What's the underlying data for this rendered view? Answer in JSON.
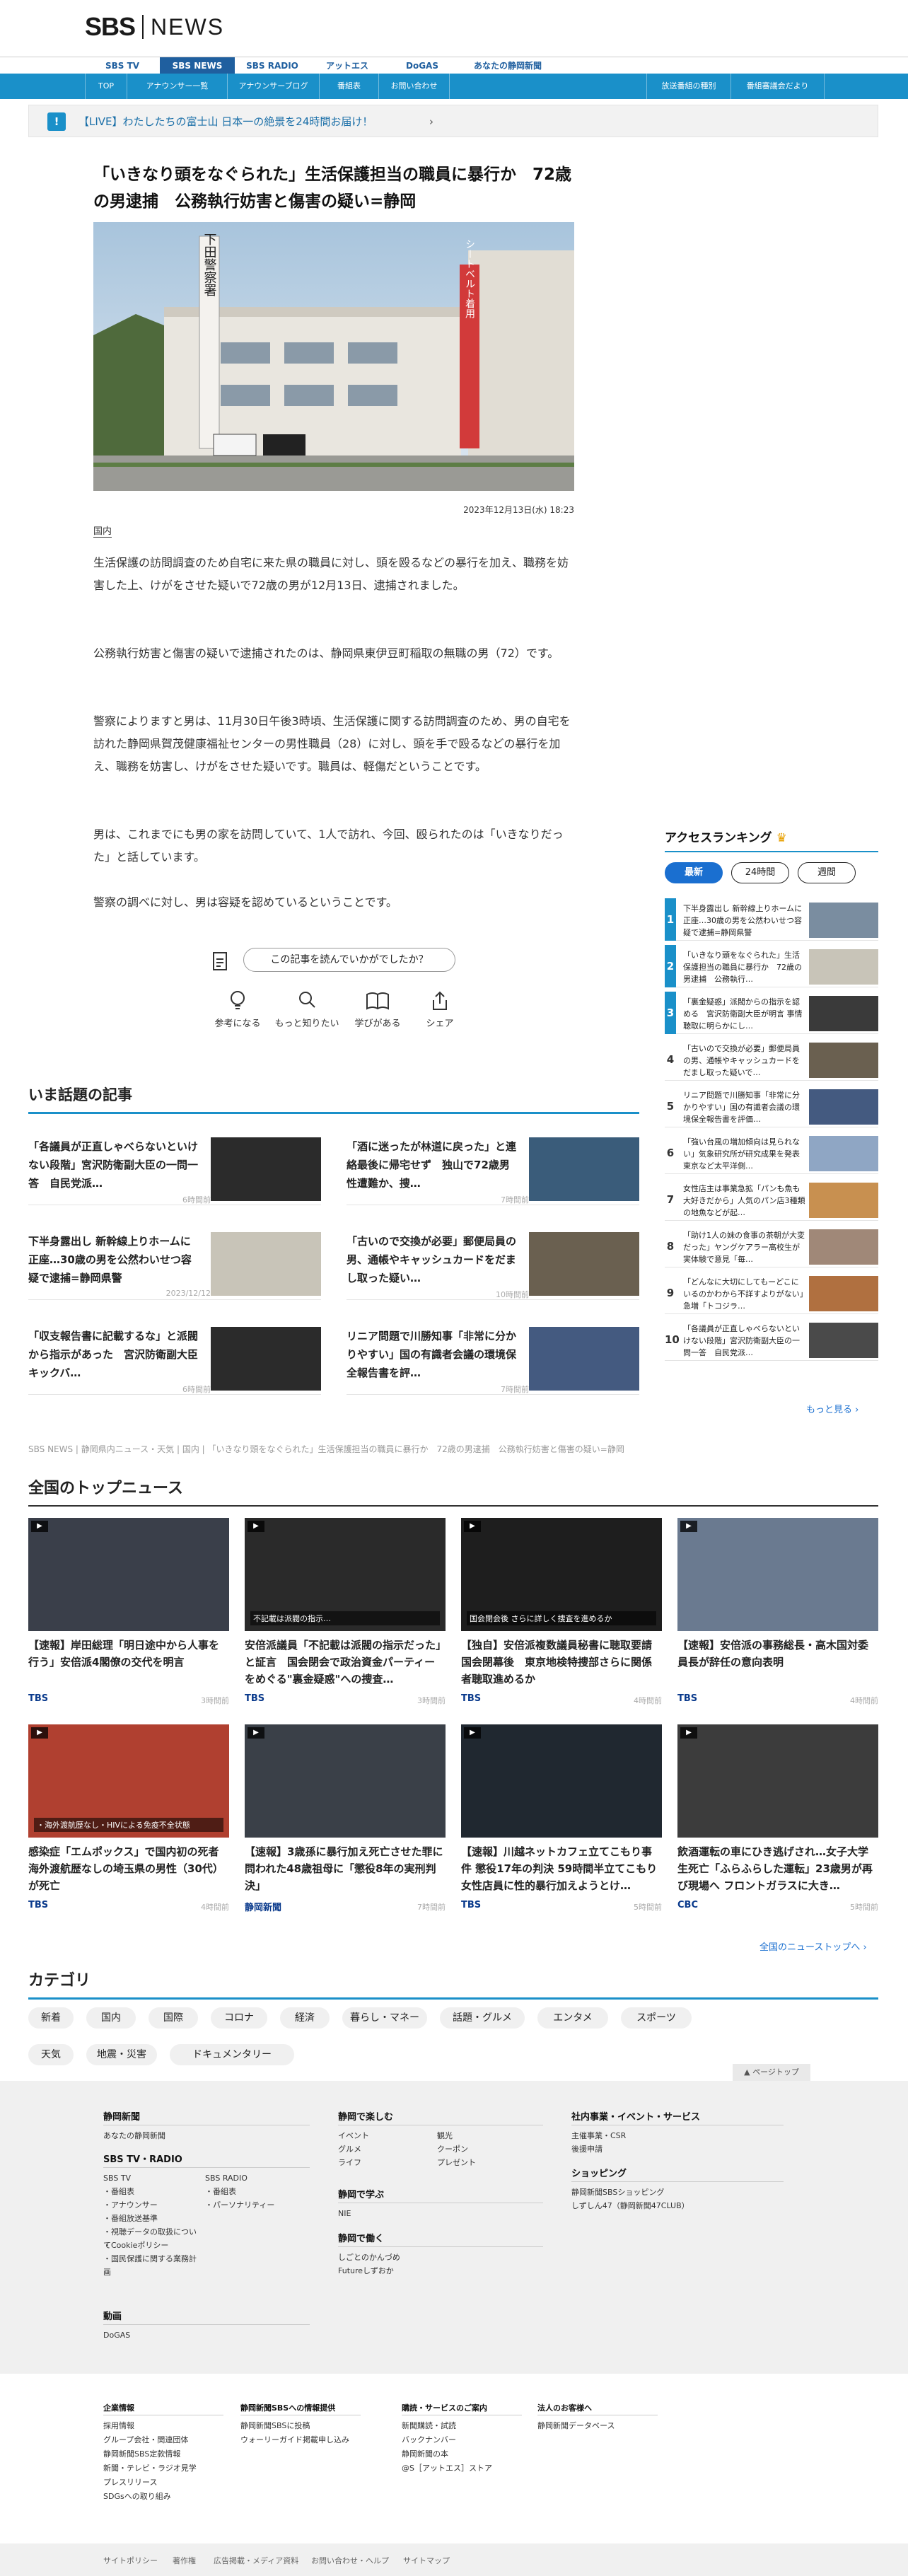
{
  "header": {
    "logo_sbs": "SBS",
    "logo_news": "NEWS",
    "service_nav": [
      "SBS TV",
      "SBS NEWS",
      "SBS RADIO",
      "アットエス",
      "DoGAS",
      "あなたの静岡新聞"
    ],
    "sub_nav": [
      "TOP",
      "アナウンサー一覧",
      "アナウンサーブログ",
      "番組表",
      "お問い合わせ",
      "放送番組の種別",
      "番組審議会だより"
    ]
  },
  "breaking": {
    "icon": "!",
    "text": "【LIVE】わたしたちの富士山 日本一の絶景を24時間お届け！",
    "chevron": "›"
  },
  "article": {
    "title": "「いきなり頭をなぐられた」生活保護担当の職員に暴行か　72歳の男逮捕　公務執行妨害と傷害の疑い=静岡",
    "photo_sign": "下田警察署",
    "photo_banner": "シートベルト着用",
    "date": "2023年12月13日(水) 18:23",
    "category": "国内",
    "paragraphs": [
      "生活保護の訪問調査のため自宅に来た県の職員に対し、頭を殴るなどの暴行を加え、職務を妨害した上、けがをさせた疑いで72歳の男が12月13日、逮捕されました。",
      "公務執行妨害と傷害の疑いで逮捕されたのは、静岡県東伊豆町稲取の無職の男（72）です。",
      "警察によりますと男は、11月30日午後3時頃、生活保護に関する訪問調査のため、男の自宅を訪れた静岡県賀茂健康福祉センターの男性職員（28）に対し、頭を手で殴るなどの暴行を加え、職務を妨害し、けがをさせた疑いです。職員は、軽傷だということです。",
      "男は、これまでにも男の家を訪問していて、1人で訪れ、今回、殴られたのは「いきなりだった」と話しています。",
      "警察の調べに対し、男は容疑を認めているということです。"
    ],
    "feedback_question": "この記事を読んでいかがでしたか？",
    "reactions": [
      "参考になる",
      "もっと知りたい",
      "学びがある",
      "シェア"
    ]
  },
  "ranking": {
    "title": "アクセスランキング",
    "tabs": [
      "最新",
      "24時間",
      "週間"
    ],
    "items": [
      {
        "num": "1",
        "title": "下半身露出し 新幹線上りホームに正座…30歳の男を公然わいせつ容疑で逮捕=静岡県警"
      },
      {
        "num": "2",
        "title": "「いきなり頭をなぐられた」生活保護担当の職員に暴行か　72歳の男逮捕　公務執行…"
      },
      {
        "num": "3",
        "title": "「裏金疑惑」派閥からの指示を認める　宮沢防衛副大臣が明言 事情聴取に明らかにし…"
      },
      {
        "num": "4",
        "title": "「古いので交換が必要」郵便局員の男、通帳やキャッシュカードをだまし取った疑いで…"
      },
      {
        "num": "5",
        "title": "リニア問題で川勝知事「非常に分かりやすい」国の有識者会議の環境保全報告書を評価…"
      },
      {
        "num": "6",
        "title": "「強い台風の増加傾向は見られない」気象研究所が研究成果を発表　東京など太平洋側…"
      },
      {
        "num": "7",
        "title": "女性店主は事業急拡「パンも魚も大好きだから」人気のパン店3種類の地魚などが起…"
      },
      {
        "num": "8",
        "title": "「助け1人の妹の食事の茶朝が大変だった」ヤングケアラー高校生が実体験で意見「毎…"
      },
      {
        "num": "9",
        "title": "「どんなに大切にしてもーどこにいるのかわから不詳すよりがない」急増「トコジラ…"
      },
      {
        "num": "10",
        "title": "「各議員が正直しゃべらないといけない段階」宮沢防衛副大臣の一問一答　自民党派…"
      }
    ],
    "more": "もっと見る ›"
  },
  "trending": {
    "title": "いま話題の記事",
    "items": [
      {
        "title": "「各議員が正直しゃべらないといけない段階」宮沢防衛副大臣の一問一答　自民党派…",
        "ago": "6時間前"
      },
      {
        "title": "「酒に迷ったが林道に戻った」と連絡最後に帰宅せず　独山で72歳男性遭難か、捜…",
        "ago": "7時間前"
      },
      {
        "title": "下半身露出し 新幹線上りホームに正座…30歳の男を公然わいせつ容疑で逮捕=静岡県警",
        "ago": "2023/12/12"
      },
      {
        "title": "「古いので交換が必要」郵便局員の男、通帳やキャッシュカードをだまし取った疑い…",
        "ago": "10時間前"
      },
      {
        "title": "「収支報告書に記載するな」と派閥から指示があった　宮沢防衛副大臣　キックバ…",
        "ago": "6時間前"
      },
      {
        "title": "リニア問題で川勝知事「非常に分かりやすい」国の有識者会議の環境保全報告書を評…",
        "ago": "7時間前"
      }
    ]
  },
  "breadcrumb": "SBS NEWS | 静岡県内ニュース・天気 | 国内 | 「いきなり頭をなぐられた」生活保護担当の職員に暴行か　72歳の男逮捕　公務執行妨害と傷害の疑い=静岡",
  "national": {
    "title": "全国のトップニュース",
    "items": [
      {
        "title": "【速報】岸田総理「明日途中から人事を行う」安倍派4閣僚の交代を明言",
        "src": "TBS",
        "ago": "3時間前",
        "caption": ""
      },
      {
        "title": "安倍派議員「不記載は派閥の指示だった」と証言　国会閉会で政治資金パーティーをめぐる\"裏金疑惑\"への捜査…",
        "src": "TBS",
        "ago": "3時間前",
        "caption": "不記載は派閥の指示…"
      },
      {
        "title": "【独自】安倍派複数議員秘書に聴取要請　国会閉幕後　東京地検特捜部さらに関係者聴取進めるか",
        "src": "TBS",
        "ago": "4時間前",
        "caption": "国会閉会後 さらに詳しく捜査を進めるか"
      },
      {
        "title": "【速報】安倍派の事務総長・高木国対委員長が辞任の意向表明",
        "src": "TBS",
        "ago": "4時間前",
        "caption": ""
      },
      {
        "title": "感染症「エムポックス」で国内初の死者 海外渡航歴なしの埼玉県の男性（30代）が死亡",
        "src": "TBS",
        "ago": "4時間前",
        "caption": "・海外渡航歴なし・HIVによる免疫不全状態"
      },
      {
        "title": "【速報】3歳孫に暴行加え死亡させた罪に問われた48歳祖母に「懲役8年の実刑判決」",
        "src": "静岡新聞",
        "ago": "7時間前",
        "caption": ""
      },
      {
        "title": "【速報】川越ネットカフェ立てこもり事件 懲役17年の判決 59時間半立てこもり女性店員に性的暴行加えようとけ…",
        "src": "TBS",
        "ago": "5時間前",
        "caption": ""
      },
      {
        "title": "飲酒運転の車にひき逃げされ…女子大学生死亡「ふらふらした運転」23歳男が再び現場へ フロントガラスに大き…",
        "src": "CBC",
        "ago": "5時間前",
        "caption": ""
      }
    ],
    "more": "全国のニューストップへ ›"
  },
  "categories": {
    "title": "カテゴリ",
    "items": [
      "新着",
      "国内",
      "国際",
      "コロナ",
      "経済",
      "暮らし・マネー",
      "話題・グルメ",
      "エンタメ",
      "スポーツ",
      "天気",
      "地震・災害",
      "ドキュメンタリー"
    ]
  },
  "footer": {
    "pagetop": "▲ ページトップ",
    "col1": {
      "h1": "静岡新聞",
      "l1": [
        "あなたの静岡新聞"
      ],
      "h2": "SBS TV・RADIO",
      "tv_h": "SBS TV",
      "tv": [
        "・番組表",
        "・アナウンサー",
        "・番組放送基準",
        "・視聴データの取扱について",
        "・Cookieポリシー",
        "・国民保護に関する業務計画"
      ],
      "radio_h": "SBS RADIO",
      "radio": [
        "・番組表",
        "・パーソナリティー"
      ],
      "h3": "動画",
      "l3": [
        "DoGAS"
      ]
    },
    "col2": {
      "h1": "静岡で楽しむ",
      "la": [
        "イベント",
        "グルメ",
        "ライフ"
      ],
      "lb": [
        "観光",
        "クーポン",
        "プレゼント"
      ],
      "h2": "静岡で学ぶ",
      "l2": [
        "NIE"
      ],
      "h3": "静岡で働く",
      "l3": [
        "しごとのかんづめ",
        "Futureしずおか"
      ]
    },
    "col3": {
      "h1": "社内事業・イベント・サービス",
      "l1": [
        "主催事業・CSR",
        "後援申請"
      ],
      "h2": "ショッピング",
      "l2": [
        "静岡新聞SBSショッピング",
        "しずしん47（静岡新聞47CLUB）"
      ]
    },
    "lower": [
      {
        "h": "企業情報",
        "l": [
          "採用情報",
          "グループ会社・関連団体",
          "静岡新聞SBS定款情報",
          "新聞・テレビ・ラジオ見学",
          "プレスリリース",
          "SDGsへの取り組み"
        ]
      },
      {
        "h": "静岡新聞SBSへの情報提供",
        "l": [
          "静岡新聞SBSに投稿",
          "ウォーリーガイド掲載申し込み"
        ]
      },
      {
        "h": "購読・サービスのご案内",
        "l": [
          "新聞購読・試読",
          "バックナンバー",
          "静岡新聞の本",
          "@S［アットエス］ストア"
        ]
      },
      {
        "h": "法人のお客様へ",
        "l": [
          "静岡新聞データベース"
        ]
      }
    ],
    "bottom": [
      "サイトポリシー",
      "著作権",
      "広告掲載・メディア資料",
      "お問い合わせ・ヘルプ",
      "サイトマップ"
    ]
  },
  "colors": {
    "accent": "#1a90c9",
    "nav": "#1f5f9f",
    "link": "#1a6fd0"
  }
}
